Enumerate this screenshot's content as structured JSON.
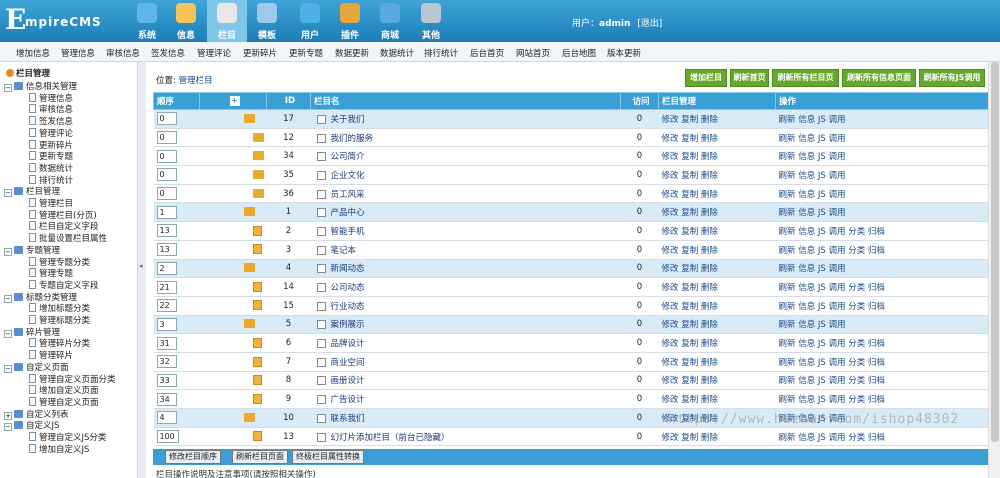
{
  "logo": {
    "big": "E",
    "rest": "mpireCMS"
  },
  "nav": [
    {
      "label": "系统",
      "icon": "globe-icon",
      "color": "#5cb6ea"
    },
    {
      "label": "信息",
      "icon": "edit-icon",
      "color": "#f6c558"
    },
    {
      "label": "栏目",
      "icon": "folder-icon",
      "color": "#e8e8e8"
    },
    {
      "label": "模板",
      "icon": "template-icon",
      "color": "#9ec9ef"
    },
    {
      "label": "用户",
      "icon": "user-icon",
      "color": "#4fb0e8"
    },
    {
      "label": "插件",
      "icon": "tools-icon",
      "color": "#e7a63a"
    },
    {
      "label": "商城",
      "icon": "shop-icon",
      "color": "#57a9e0"
    },
    {
      "label": "其他",
      "icon": "gear-icon",
      "color": "#b9c6d3"
    }
  ],
  "user": {
    "prefix": "用户：",
    "name": "admin",
    "logout": "[退出]"
  },
  "submenu": [
    "增加信息",
    "管理信息",
    "审核信息",
    "签发信息",
    "管理评论",
    "更新碎片",
    "更新专题",
    "数据更新",
    "数据统计",
    "排行统计",
    "后台首页",
    "网站首页",
    "后台地图",
    "版本更新"
  ],
  "sidebar": {
    "title": "栏目管理",
    "groups": [
      {
        "label": "信息相关管理",
        "items": [
          "管理信息",
          "审核信息",
          "签发信息",
          "管理评论",
          "更新碎片",
          "更新专题",
          "数据统计",
          "排行统计"
        ]
      },
      {
        "label": "栏目管理",
        "items": [
          "管理栏目",
          "管理栏目(分页)",
          "栏目自定义字段",
          "批量设置栏目属性"
        ]
      },
      {
        "label": "专题管理",
        "items": [
          "管理专题分类",
          "管理专题",
          "专题自定义字段"
        ]
      },
      {
        "label": "标题分类管理",
        "items": [
          "增加标题分类",
          "管理标题分类"
        ]
      },
      {
        "label": "碎片管理",
        "items": [
          "管理碎片分类",
          "管理碎片"
        ]
      },
      {
        "label": "自定义页面",
        "items": [
          "管理自定义页面分类",
          "增加自定义页面",
          "管理自定义页面"
        ]
      },
      {
        "label": "自定义列表",
        "items": []
      },
      {
        "label": "自定义JS",
        "items": [
          "管理自定义JS分类",
          "增加自定义JS"
        ]
      }
    ]
  },
  "location": {
    "prefix": "位置:",
    "link": "管理栏目"
  },
  "buttons": [
    "增加栏目",
    "刷新首页",
    "刷新所有栏目页",
    "刷新所有信息页面",
    "刷新所有JS调用"
  ],
  "table": {
    "headers": [
      "顺序",
      "+",
      "ID",
      "栏目名",
      "访问",
      "栏目管理",
      "操作"
    ],
    "rows": [
      {
        "order": "0",
        "id": "17",
        "name": "关于我们",
        "visits": "0",
        "type": "top",
        "ops": "刷新 信息 JS 调用"
      },
      {
        "order": "0",
        "id": "12",
        "name": "我们的服务",
        "visits": "0",
        "type": "sub",
        "ops": "刷新 信息 JS 调用"
      },
      {
        "order": "0",
        "id": "34",
        "name": "公司简介",
        "visits": "0",
        "type": "sub",
        "ops": "刷新 信息 JS 调用"
      },
      {
        "order": "0",
        "id": "35",
        "name": "企业文化",
        "visits": "0",
        "type": "sub",
        "ops": "刷新 信息 JS 调用"
      },
      {
        "order": "0",
        "id": "36",
        "name": "员工风采",
        "visits": "0",
        "type": "sub",
        "ops": "刷新 信息 JS 调用"
      },
      {
        "order": "1",
        "id": "1",
        "name": "产品中心",
        "visits": "0",
        "type": "top",
        "ops": "刷新 信息 JS 调用"
      },
      {
        "order": "13",
        "id": "2",
        "name": "智能手机",
        "visits": "0",
        "type": "leaf",
        "ops": "刷新 信息 JS 调用 分类 归档"
      },
      {
        "order": "13",
        "id": "3",
        "name": "笔记本",
        "visits": "0",
        "type": "leaf",
        "ops": "刷新 信息 JS 调用 分类 归档"
      },
      {
        "order": "2",
        "id": "4",
        "name": "新闻动态",
        "visits": "0",
        "type": "top",
        "ops": "刷新 信息 JS 调用"
      },
      {
        "order": "21",
        "id": "14",
        "name": "公司动态",
        "visits": "0",
        "type": "leaf",
        "ops": "刷新 信息 JS 调用 分类 归档"
      },
      {
        "order": "22",
        "id": "15",
        "name": "行业动态",
        "visits": "0",
        "type": "leaf",
        "ops": "刷新 信息 JS 调用 分类 归档"
      },
      {
        "order": "3",
        "id": "5",
        "name": "案例展示",
        "visits": "0",
        "type": "top",
        "ops": "刷新 信息 JS 调用"
      },
      {
        "order": "31",
        "id": "6",
        "name": "品牌设计",
        "visits": "0",
        "type": "leaf",
        "ops": "刷新 信息 JS 调用 分类 归档"
      },
      {
        "order": "32",
        "id": "7",
        "name": "商业空间",
        "visits": "0",
        "type": "leaf",
        "ops": "刷新 信息 JS 调用 分类 归档"
      },
      {
        "order": "33",
        "id": "8",
        "name": "画册设计",
        "visits": "0",
        "type": "leaf",
        "ops": "刷新 信息 JS 调用 分类 归档"
      },
      {
        "order": "34",
        "id": "9",
        "name": "广告设计",
        "visits": "0",
        "type": "leaf",
        "ops": "刷新 信息 JS 调用 分类 归档"
      },
      {
        "order": "4",
        "id": "10",
        "name": "联系我们",
        "visits": "0",
        "type": "top",
        "ops": "刷新 信息 JS 调用"
      },
      {
        "order": "100",
        "id": "13",
        "name": "幻灯片添加栏目（前台已隐藏）",
        "visits": "0",
        "type": "leaf",
        "ops": "刷新 信息 JS 调用 分类 归档"
      }
    ],
    "manage": "修改 复制 删除"
  },
  "bottom_buttons": [
    "修改栏目顺序",
    "刷新栏目页面",
    "终极栏目属性转换"
  ],
  "cutoff_text": "栏目操作说明及注意事项(请按照相关操作)",
  "watermark": "https://www.huzhan.com/ishop48302"
}
